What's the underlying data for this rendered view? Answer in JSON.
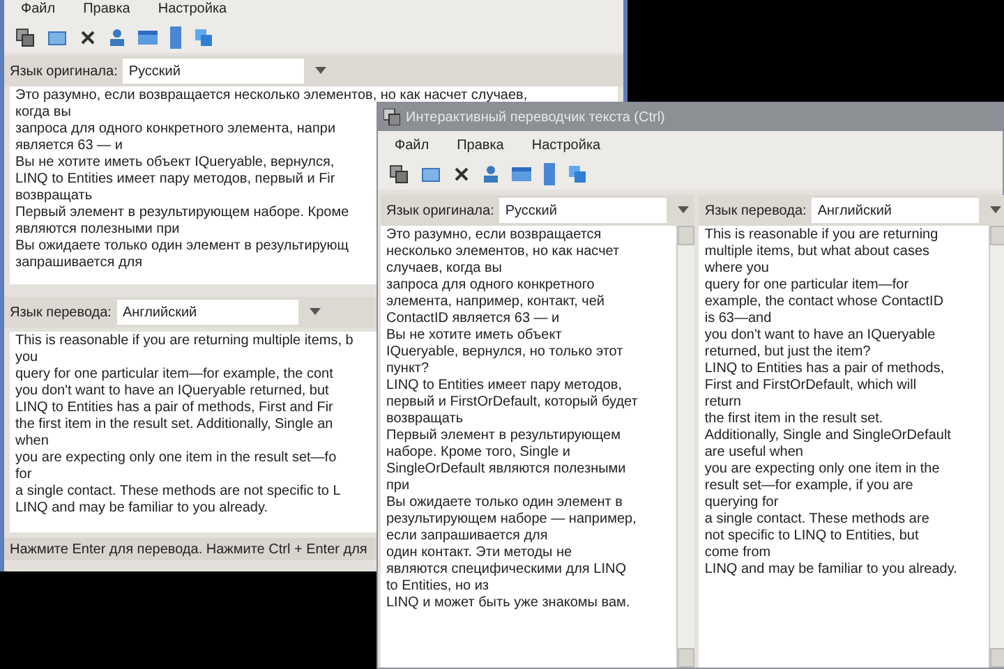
{
  "back_window": {
    "menu": [
      "Файл",
      "Правка",
      "Настройка"
    ],
    "source": {
      "label": "Язык оригинала:",
      "language": "Русский",
      "lines": [
        "Это разумно, если возвращается несколько элементов, но как насчет случаев,",
        "когда вы",
        "запроса для одного конкретного элемента, напри",
        "является 63 — и",
        "Вы не хотите иметь объект IQueryable, вернулся,",
        "LINQ to Entities имеет пару методов, первый и Fir",
        "возвращать",
        "Первый элемент в результирующем наборе. Кроме",
        "являются полезными при",
        "Вы ожидаете только один элемент в результирующ",
        "запрашивается для"
      ]
    },
    "target": {
      "label": "Язык перевода:",
      "language": "Английский",
      "lines": [
        "This is reasonable if you are returning multiple items, b",
        "you",
        "query for one particular item—for example, the cont",
        "you don't want to have an IQueryable returned, but",
        "LINQ to Entities has a pair of methods, First and Fir",
        "the first item in the result set. Additionally, Single an",
        "when",
        "you are expecting only one item in the result set—fo",
        "for",
        "a single contact. These methods are not specific to L",
        "LINQ and may be familiar to you already."
      ]
    },
    "status_bar": "Нажмите Enter для перевода. Нажмите Ctrl + Enter для"
  },
  "front_window": {
    "title": "Интерактивный переводчик текста (Ctrl)",
    "menu": [
      "Файл",
      "Правка",
      "Настройка"
    ],
    "source": {
      "label": "Язык оригинала:",
      "language": "Русский",
      "lines": [
        "Это разумно, если возвращается",
        "несколько элементов, но как насчет",
        "случаев, когда вы",
        "запроса для одного конкретного",
        "элемента, например, контакт, чей",
        "ContactID является 63 — и",
        "Вы не хотите иметь объект",
        "IQueryable, вернулся, но только этот",
        "пункт?",
        "LINQ to Entities имеет пару методов,",
        "первый и FirstOrDefault, который будет",
        "возвращать",
        "Первый элемент в результирующем",
        "наборе. Кроме того, Single и",
        "SingleOrDefault являются полезными",
        "при",
        "Вы ожидаете только один элемент в",
        "результирующем наборе — например,",
        "если запрашивается для",
        "один контакт. Эти методы не",
        "являются специфическими для LINQ",
        "to Entities, но из",
        "LINQ и может быть уже знакомы вам."
      ]
    },
    "target": {
      "label": "Язык перевода:",
      "language": "Английский",
      "lines": [
        "This is reasonable if you are returning",
        "multiple items, but what about cases",
        "where you",
        "query for one particular item—for",
        "example, the contact whose ContactID",
        "is 63—and",
        "you don't want to have an IQueryable",
        "returned, but just the item?",
        "LINQ to Entities has a pair of methods,",
        "First and FirstOrDefault, which will",
        "return",
        "the first item in the result set.",
        "Additionally, Single and SingleOrDefault",
        "are useful when",
        "you are expecting only one item in the",
        "result set—for example, if you are",
        "querying for",
        "a single contact. These methods are",
        "not specific to LINQ to Entities, but",
        "come from",
        "LINQ and may be familiar to you already."
      ]
    }
  }
}
